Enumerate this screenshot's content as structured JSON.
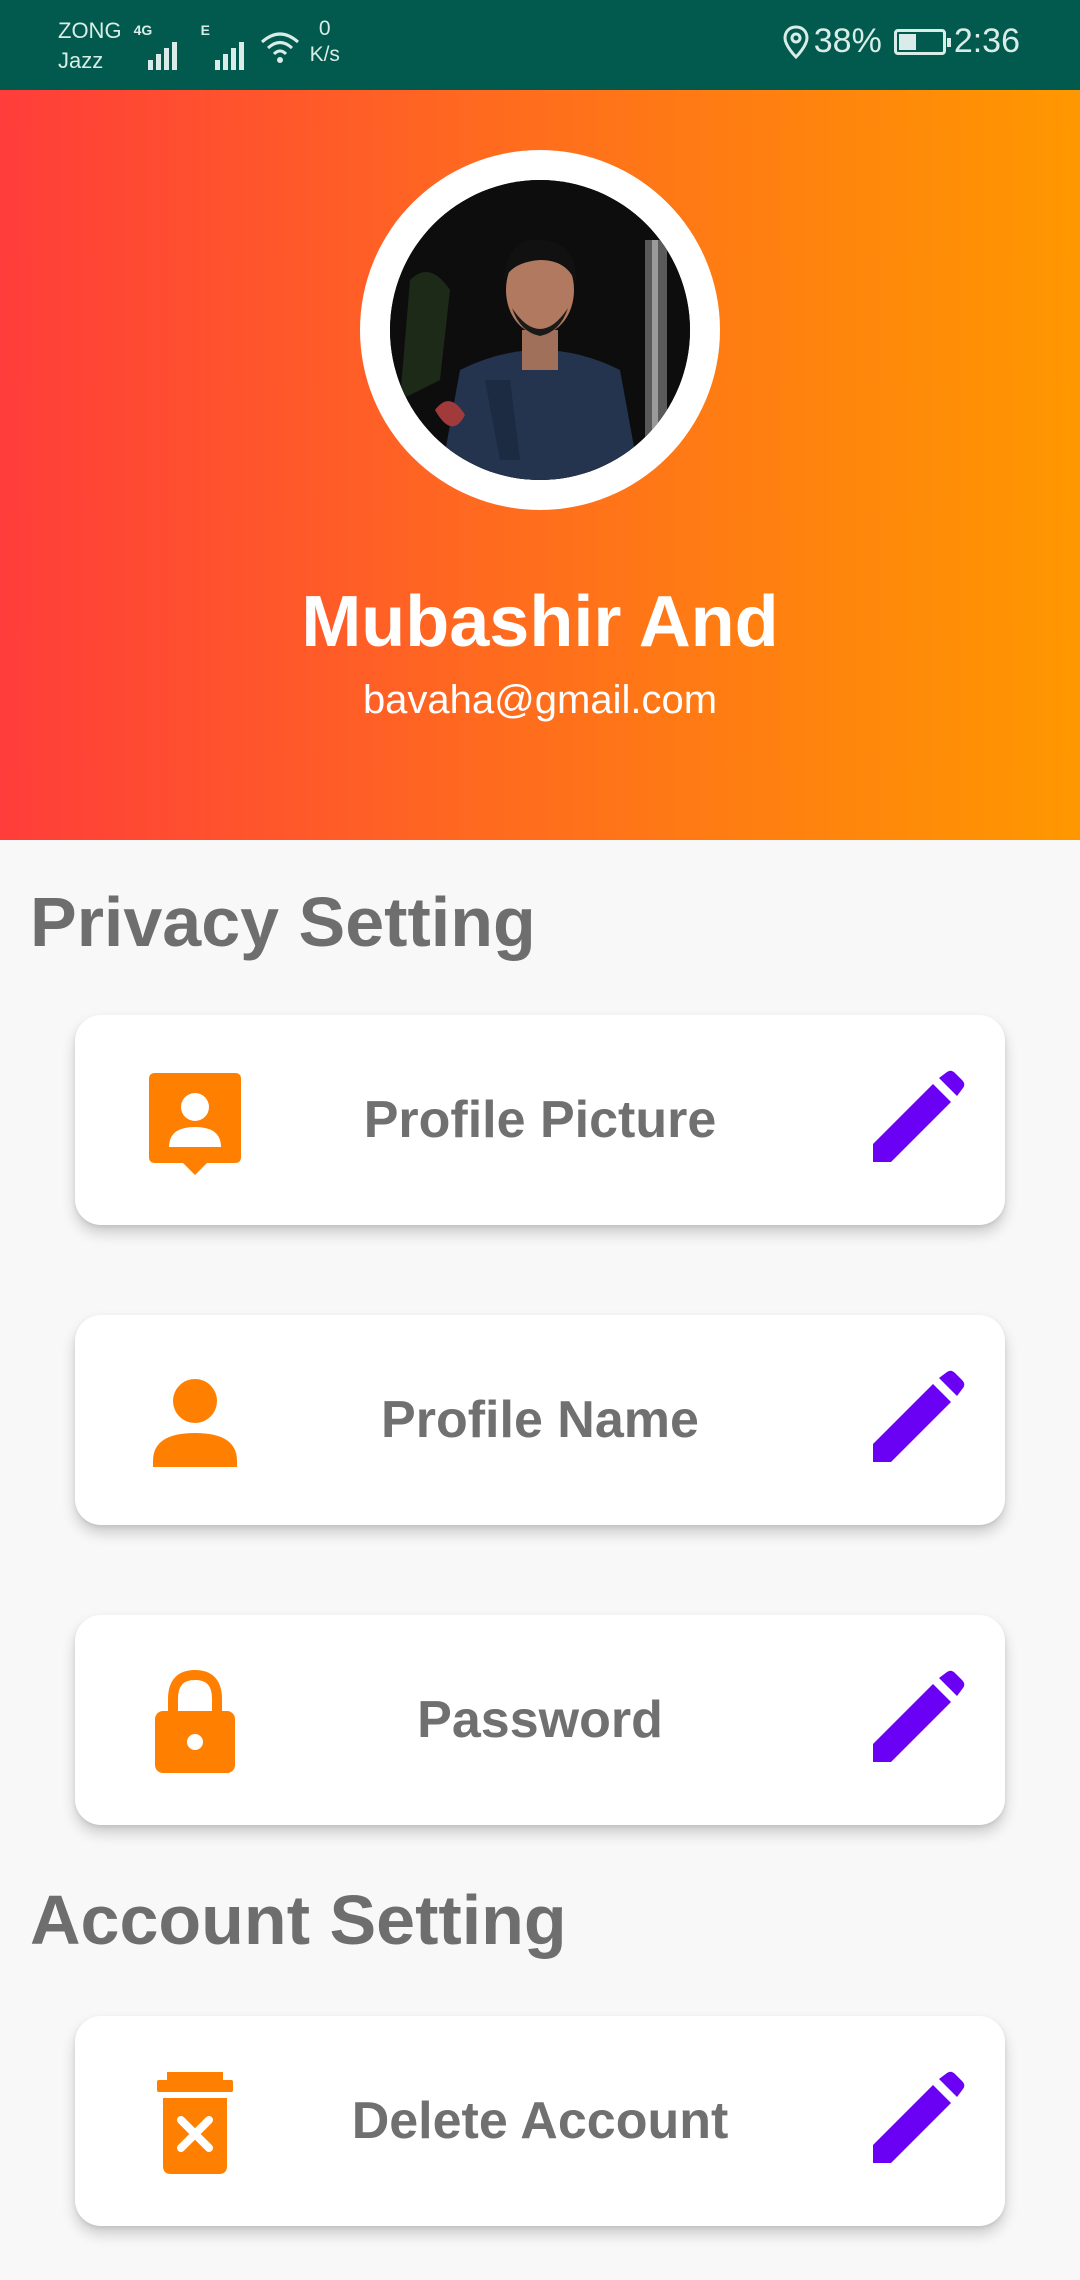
{
  "status_bar": {
    "carrier_1": "ZONG",
    "carrier_2": "Jazz",
    "sim1_type": "4G",
    "sim2_type": "E",
    "net_speed_value": "0",
    "net_speed_unit": "K/s",
    "battery": "38%",
    "time": "2:36"
  },
  "profile": {
    "name": "Mubashir And",
    "email": "bavaha@gmail.com"
  },
  "privacy": {
    "title": "Privacy Setting",
    "items": [
      {
        "label": "Profile Picture",
        "icon": "account-box-icon"
      },
      {
        "label": "Profile Name",
        "icon": "person-icon"
      },
      {
        "label": "Password",
        "icon": "lock-icon"
      }
    ]
  },
  "account": {
    "title": "Account Setting",
    "items": [
      {
        "label": "Delete Account",
        "icon": "delete-icon"
      }
    ]
  },
  "colors": {
    "status_bar": "#015a4d",
    "gradient_start": "#ff3d3a",
    "gradient_end": "#ff9800",
    "icon_orange": "#ff7f00",
    "edit_purple": "#6a00f4",
    "label_gray": "#707070"
  }
}
